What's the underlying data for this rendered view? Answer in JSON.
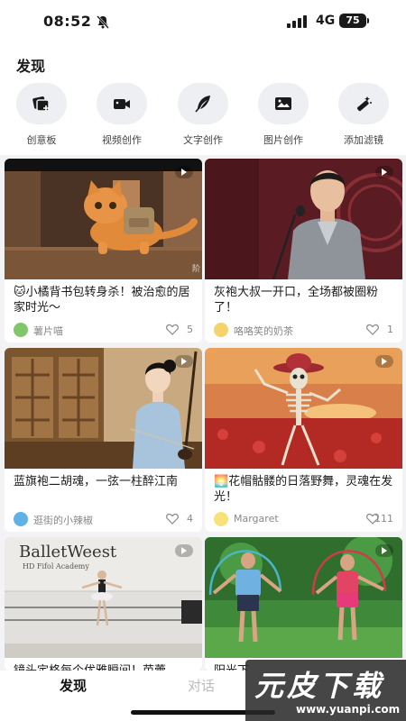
{
  "status_bar": {
    "time": "08:52",
    "network": "4G",
    "battery": "75"
  },
  "header": {
    "title": "发现"
  },
  "tools": [
    {
      "label": "创意板",
      "icon": "creative-board-icon"
    },
    {
      "label": "视频创作",
      "icon": "video-camera-icon"
    },
    {
      "label": "文字创作",
      "icon": "feather-pen-icon"
    },
    {
      "label": "图片创作",
      "icon": "image-icon"
    },
    {
      "label": "添加滤镜",
      "icon": "magic-wand-icon"
    }
  ],
  "cards": [
    {
      "title": "🐱小橘背书包转身杀！被治愈的居家时光～",
      "author": "薯片喵",
      "likes": "5",
      "overlay": "阶"
    },
    {
      "title": "灰袍大叔一开口，全场都被圈粉了！",
      "author": "咯咯笑的奶茶",
      "likes": "1"
    },
    {
      "title": "蓝旗袍二胡魂，一弦一柱醉江南",
      "author": "逛街的小辣椒",
      "likes": "4"
    },
    {
      "title": "🌅花帽骷髅的日落野舞，灵魂在发光！",
      "author": "Margaret",
      "likes": "111"
    },
    {
      "title": "镜头定格每个优雅瞬间！芭蕾",
      "author": "",
      "likes": "",
      "scene_text_1": "BalletWeest",
      "scene_text_2": "HD Fifol Academy"
    },
    {
      "title": "阳光下",
      "author": "",
      "likes": ""
    }
  ],
  "bottom_nav": {
    "discover": "发现",
    "chat": "对话"
  },
  "watermark": {
    "brand": "元皮下载",
    "url": "www.yuanpi.com"
  }
}
